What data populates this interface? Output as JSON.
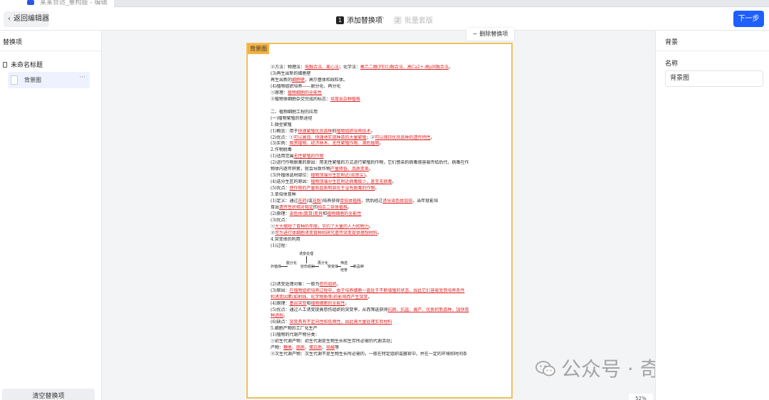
{
  "browser": {
    "tab_title": "某某合适_重构版 - 编辑"
  },
  "topbar": {
    "back_label": "返回编辑器",
    "steps": [
      {
        "num": "1",
        "label": "添加替换项"
      },
      {
        "num": "2",
        "label": "批量套版"
      }
    ],
    "next_label": "下一步"
  },
  "left_panel": {
    "title": "替换项",
    "root_label": "未命名标题",
    "item_label": "背景图",
    "clear_label": "清空替换项"
  },
  "canvas": {
    "delete_label": "删除替换项",
    "page_tag": "背景图",
    "zoom": "52%",
    "watermark": "公众号 · 奇怪思维",
    "doc_lines": [
      [
        {
          "t": "②方法：物理法："
        },
        {
          "t": "电融合法、离心法",
          "r": true
        },
        {
          "t": "；化学法："
        },
        {
          "t": "聚乙二醇(PEG)融合法、高Ca2+-高pH融合法",
          "r": true
        },
        {
          "t": "。"
        }
      ],
      [
        {
          "t": "(3)再生出新的细胞壁"
        }
      ],
      [
        {
          "t": "再生出新的"
        },
        {
          "t": "细胞壁",
          "r": true
        },
        {
          "t": "，高尔基体和线粒体。"
        }
      ],
      [
        {
          "t": "(4)植物组织培养——脱分化、再分化"
        }
      ],
      [
        {
          "t": "①原理："
        },
        {
          "t": "植物细胞的全能性",
          "r": true
        }
      ],
      [
        {
          "t": "②植物体细胞杂交完成的标志："
        },
        {
          "t": "培育出杂种植株",
          "r": true
        }
      ],
      [
        {
          "gap": true
        }
      ],
      [
        {
          "t": "二、植物细胞工程的应用"
        }
      ],
      [
        {
          "t": "(一)植物繁殖的新途径"
        }
      ],
      [
        {
          "t": "1.微型繁殖"
        }
      ],
      [
        {
          "t": "(1)概念：用于"
        },
        {
          "t": "快速繁殖优良品种",
          "r": true
        },
        {
          "t": "的"
        },
        {
          "t": "植物组织培养技术",
          "r": true
        },
        {
          "t": "。"
        }
      ],
      [
        {
          "t": "(2)优点：①"
        },
        {
          "t": "可以高效、快速地实现种苗的大量繁殖",
          "r": true
        },
        {
          "t": "；②"
        },
        {
          "t": "可以保持优良品种的遗传特性",
          "r": true
        },
        {
          "t": "。"
        }
      ],
      [
        {
          "t": "(3)实例："
        },
        {
          "t": "观赏植物、经济林木、无性繁殖作物、濒危植物",
          "r": true
        },
        {
          "t": "。"
        }
      ],
      [
        {
          "t": "2.作物脱毒"
        }
      ],
      [
        {
          "t": "(1)适用范围"
        },
        {
          "t": "无性繁殖的作物",
          "r": true
        }
      ],
      [
        {
          "t": "(2)进行作物脱毒的原因：用无性繁殖的方式进行繁殖的作物，它们感染的病毒很容易传给后代，病毒在作"
        }
      ],
      [
        {
          "t": "物体内逐年积累，就会导致作物"
        },
        {
          "t": "产量降低、品质变差",
          "r": true
        },
        {
          "t": "。"
        }
      ],
      [
        {
          "t": "(3)外植体选材部位："
        },
        {
          "t": "植物顶端分生区附近(如茎尖)",
          "r": true
        },
        {
          "t": "。"
        }
      ],
      [
        {
          "t": "(4)选分生区的原因："
        },
        {
          "t": "植物顶端分生区附近病毒极少，甚至无病毒",
          "r": true
        },
        {
          "t": "。"
        }
      ],
      [
        {
          "t": "(5)优点："
        },
        {
          "t": "使作物的产量和品质明显优于没有脱毒的作物",
          "r": true
        },
        {
          "t": "。"
        }
      ],
      [
        {
          "t": "3.单倍体育种"
        }
      ],
      [
        {
          "t": "(1)定义：通过"
        },
        {
          "t": "花药",
          "r": true
        },
        {
          "t": "(或"
        },
        {
          "t": "花粉",
          "r": true
        },
        {
          "t": ")培养获得"
        },
        {
          "t": "单倍体植株",
          "r": true
        },
        {
          "t": "，然后经过"
        },
        {
          "t": "诱导染色体加倍",
          "r": true
        },
        {
          "t": "，当年"
        },
        {
          "t": "就能培"
        }
      ],
      [
        {
          "t": "育出"
        },
        {
          "t": "遗传性状相对稳定",
          "r": true
        },
        {
          "t": "的"
        },
        {
          "t": "纯合二倍体植株",
          "r": true
        },
        {
          "t": "。"
        }
      ],
      [
        {
          "t": "(2)原理："
        },
        {
          "t": "染色体(数目)变异",
          "r": true
        },
        {
          "t": "和"
        },
        {
          "t": "植物细胞的全能性",
          "r": true
        }
      ],
      [
        {
          "t": "(3)优点："
        }
      ],
      [
        {
          "t": "①"
        },
        {
          "t": "大大缩短了育种的年限，节约了大量的人力和物力",
          "r": true
        },
        {
          "t": "。"
        }
      ],
      [
        {
          "t": "②"
        },
        {
          "t": "可为进行体细胞诱变育种和研究遗传突变提供理想材料",
          "r": true
        },
        {
          "t": "。"
        }
      ],
      [
        {
          "t": "4.突变体的利用"
        }
      ],
      [
        {
          "t": "(1)过程："
        }
      ],
      [
        {
          "flow": true
        }
      ],
      [
        {
          "t": "(2)诱变处理对象：一般为"
        },
        {
          "t": "愈伤组织",
          "r": true
        },
        {
          "t": "。"
        }
      ],
      [
        {
          "t": "(3)原因："
        },
        {
          "t": "在植物组织培养过程中，由于培养细胞一直处于不断增殖的状态，因此它们容易受到培养条件",
          "r": true
        }
      ],
      [
        {
          "t": "和诱变因素(如射线、化学物质等)的影响而产生突变",
          "r": true
        },
        {
          "t": "。"
        }
      ],
      [
        {
          "t": "(4)原理："
        },
        {
          "t": "基因突变",
          "r": true
        },
        {
          "t": "和"
        },
        {
          "t": "植物细胞的全能性",
          "r": true
        },
        {
          "t": "。"
        }
      ],
      [
        {
          "t": "(5)优点：通过人工诱变提高愈伤组织的突变率，从而筛选获得"
        },
        {
          "t": "抗病、抗盐、高产、优质的新品种，加快育",
          "r": true
        }
      ],
      [
        {
          "t": "种进程",
          "r": true
        },
        {
          "t": "。"
        }
      ],
      [
        {
          "t": "(6)缺点："
        },
        {
          "t": "突变具有不定向性和低频性，因此需大量处理实验材料",
          "r": true
        }
      ],
      [
        {
          "t": "5.细胞产物的工厂化生产"
        }
      ],
      [
        {
          "t": "(1)植物的代谢产物分类："
        }
      ],
      [
        {
          "t": "①初生代谢产物：初生代谢是生物生长和生存所必需的代谢活动；"
        }
      ],
      [
        {
          "t": "产物："
        },
        {
          "t": "糖类",
          "r": true
        },
        {
          "t": "、"
        },
        {
          "t": "脂质",
          "r": true
        },
        {
          "t": "、"
        },
        {
          "t": "蛋白质",
          "r": true
        },
        {
          "t": "、"
        },
        {
          "t": "核酸",
          "r": true
        },
        {
          "t": "等"
        }
      ],
      [
        {
          "t": "②次生代谢产物：次生代谢不是生物生长所必需的，一般在特定组织或器官中，并在一定的环境和时间条"
        }
      ]
    ],
    "flow_labels": {
      "explant": "外植体",
      "dediff": "脱分化",
      "callus": "愈伤组织",
      "mutagen": "诱变处理",
      "rediff": "再分化",
      "mutant": "突变体",
      "screen": "筛选",
      "cultivate": "培育",
      "newvar": "新品种"
    }
  },
  "right_panel": {
    "title": "背景",
    "name_label": "名称",
    "name_value": "背景图"
  }
}
